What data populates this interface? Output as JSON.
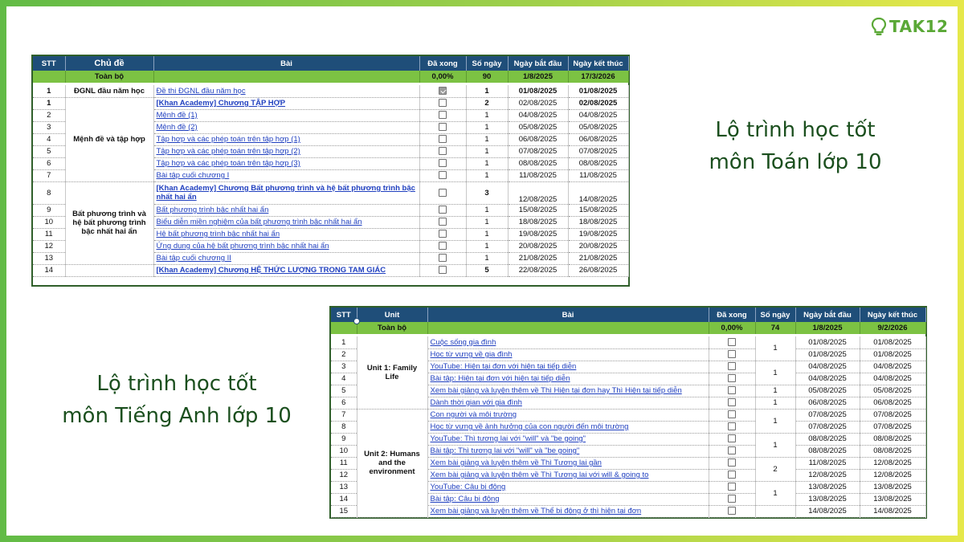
{
  "brand": {
    "logo_text": "TAK12",
    "color": "#5aa836"
  },
  "math": {
    "heading_line1": "Lộ trình học tốt",
    "heading_line2": "môn Toán lớp 10",
    "columns": [
      "STT",
      "Chủ đề",
      "Bài",
      "Đã xong",
      "Số ngày",
      "Ngày bắt đầu",
      "Ngày kết thúc"
    ],
    "total": {
      "label": "Toàn bộ",
      "done": "0,00%",
      "days": "90",
      "start": "1/8/2025",
      "end": "17/3/2026"
    },
    "rows": [
      {
        "stt": "1",
        "topic": "ĐGNL đầu năm học",
        "lesson": "Đề thi ĐGNL đầu năm học",
        "checked": true,
        "days": "1",
        "start": "01/08/2025",
        "end": "01/08/2025"
      },
      {
        "stt": "1",
        "topic": "Mệnh đề và tập hợp",
        "lesson": "[Khan Academy] Chương TẬP HỢP",
        "checked": false,
        "days": "2",
        "start": "02/08/2025",
        "end": "02/08/2025"
      },
      {
        "stt": "2",
        "lesson": "Mệnh đề (1)",
        "checked": false,
        "days": "1",
        "start": "04/08/2025",
        "end": "04/08/2025"
      },
      {
        "stt": "3",
        "lesson": "Mệnh đề (2)",
        "checked": false,
        "days": "1",
        "start": "05/08/2025",
        "end": "05/08/2025"
      },
      {
        "stt": "4",
        "lesson": "Tập hợp và các phép toán trên tập hợp (1)",
        "checked": false,
        "days": "1",
        "start": "06/08/2025",
        "end": "06/08/2025"
      },
      {
        "stt": "5",
        "lesson": "Tập hợp và các phép toán trên tập hợp (2)",
        "checked": false,
        "days": "1",
        "start": "07/08/2025",
        "end": "07/08/2025"
      },
      {
        "stt": "6",
        "lesson": "Tập hợp và các phép toán trên tập hợp (3)",
        "checked": false,
        "days": "1",
        "start": "08/08/2025",
        "end": "08/08/2025"
      },
      {
        "stt": "7",
        "lesson": "Bài tập cuối chương I",
        "checked": false,
        "days": "1",
        "start": "11/08/2025",
        "end": "11/08/2025"
      },
      {
        "stt": "8",
        "topic": "Bất phương trình và hệ bất phương trình bậc nhất hai ẩn",
        "lesson": "[Khan Academy] Chương Bất phương trình và hệ bất phương trình bậc nhất hai ẩn",
        "checked": false,
        "days": "3",
        "start": "12/08/2025",
        "end": "14/08/2025"
      },
      {
        "stt": "9",
        "lesson": "Bất phương trình bậc nhất hai ẩn",
        "checked": false,
        "days": "1",
        "start": "15/08/2025",
        "end": "15/08/2025"
      },
      {
        "stt": "10",
        "lesson": "Biểu diễn miền nghiệm của bất phương trình bậc nhất hai ẩn",
        "checked": false,
        "days": "1",
        "start": "18/08/2025",
        "end": "18/08/2025"
      },
      {
        "stt": "11",
        "lesson": "Hệ bất phương trình bậc nhất hai ẩn",
        "checked": false,
        "days": "1",
        "start": "19/08/2025",
        "end": "19/08/2025"
      },
      {
        "stt": "12",
        "lesson": "Ứng dụng của hệ bất phương trình bậc nhất hai ẩn",
        "checked": false,
        "days": "1",
        "start": "20/08/2025",
        "end": "20/08/2025"
      },
      {
        "stt": "13",
        "lesson": "Bài tập cuối chương II",
        "checked": false,
        "days": "1",
        "start": "21/08/2025",
        "end": "21/08/2025"
      },
      {
        "stt": "14",
        "lesson": "[Khan Academy] Chương HỆ THỨC LƯỢNG TRONG TAM GIÁC",
        "checked": false,
        "days": "5",
        "start": "22/08/2025",
        "end": "26/08/2025"
      }
    ]
  },
  "english": {
    "heading_line1": "Lộ trình học tốt",
    "heading_line2": "môn Tiếng Anh lớp 10",
    "columns": [
      "STT",
      "Unit",
      "Bài",
      "Đã xong",
      "Số ngày",
      "Ngày bắt đầu",
      "Ngày kết thúc"
    ],
    "total": {
      "label": "Toàn bộ",
      "done": "0,00%",
      "days": "74",
      "start": "1/8/2025",
      "end": "9/2/2026"
    },
    "unit1": "Unit 1: Family Life",
    "unit2": "Unit 2: Humans and the environment",
    "rows": [
      {
        "stt": "1",
        "lesson": "Cuộc sống gia đình",
        "start": "01/08/2025",
        "end": "01/08/2025"
      },
      {
        "stt": "2",
        "lesson": "Học từ vựng về gia đình",
        "start": "01/08/2025",
        "end": "01/08/2025"
      },
      {
        "stt": "3",
        "lesson": "YouTube: Hiện tại đơn với hiện tại tiếp diễn",
        "start": "04/08/2025",
        "end": "04/08/2025"
      },
      {
        "stt": "4",
        "lesson": "Bài tập: Hiện tại đơn với hiện tại tiếp diễn",
        "start": "04/08/2025",
        "end": "04/08/2025"
      },
      {
        "stt": "5",
        "lesson": "Xem bài giảng và luyện thêm về Thì Hiện tại đơn hay Thì Hiện tại tiếp diễn",
        "start": "05/08/2025",
        "end": "05/08/2025"
      },
      {
        "stt": "6",
        "lesson": "Dành thời gian với gia đình",
        "start": "06/08/2025",
        "end": "06/08/2025"
      },
      {
        "stt": "7",
        "lesson": "Con người và môi trường",
        "start": "07/08/2025",
        "end": "07/08/2025"
      },
      {
        "stt": "8",
        "lesson": "Học từ vựng về ảnh hưởng của con người đến môi trường",
        "start": "07/08/2025",
        "end": "07/08/2025"
      },
      {
        "stt": "9",
        "lesson": "YouTube: Thì tương lai với \"will\" và \"be going\"",
        "start": "08/08/2025",
        "end": "08/08/2025"
      },
      {
        "stt": "10",
        "lesson": "Bài tập: Thì tương lai với \"will\" và \"be going\"",
        "start": "08/08/2025",
        "end": "08/08/2025"
      },
      {
        "stt": "11",
        "lesson": "Xem bài giảng và luyện thêm về Thì Tương lai gần",
        "start": "11/08/2025",
        "end": "12/08/2025"
      },
      {
        "stt": "12",
        "lesson": "Xem bài giảng và luyện thêm về Thì Tương lai với will & going to",
        "start": "12/08/2025",
        "end": "12/08/2025"
      },
      {
        "stt": "13",
        "lesson": "YouTube: Câu bị động",
        "start": "13/08/2025",
        "end": "13/08/2025"
      },
      {
        "stt": "14",
        "lesson": "Bài tập: Câu bị động",
        "start": "13/08/2025",
        "end": "13/08/2025"
      },
      {
        "stt": "15",
        "lesson": "Xem bài giảng và luyện thêm về Thể bị động ở thì hiện tại đơn",
        "start": "14/08/2025",
        "end": "14/08/2025"
      }
    ],
    "day_groups": [
      "1",
      "1",
      "1",
      "1",
      "1",
      "2",
      "1",
      "1"
    ]
  }
}
